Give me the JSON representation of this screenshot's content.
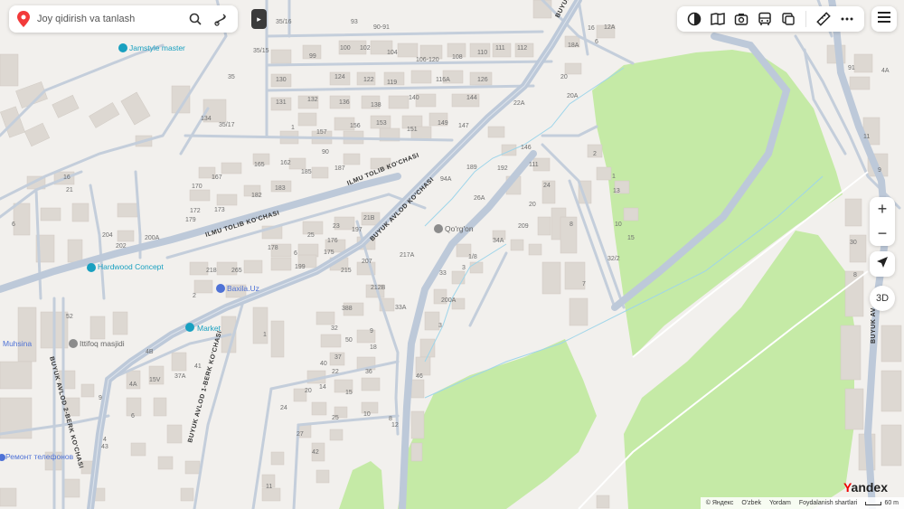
{
  "search": {
    "placeholder": "Joy qidirish va tanlash"
  },
  "map": {
    "streets": [
      {
        "name": "BUYUK AVLOD KO'CHASI"
      },
      {
        "name": "ILMU TOLIB KO'CHASI"
      },
      {
        "name": "ILMU TOLIB KO'CHASI"
      },
      {
        "name": "BUYUK AVLOD 1-BERK KO'CHASI"
      },
      {
        "name": "BUYUK AVLOD 2-BERK KO'CHASI"
      },
      {
        "name": "BUYUK AVLOD KO'CHASI"
      },
      {
        "name": "BUYUK AV"
      }
    ],
    "pois": [
      {
        "name": "Jamstyle master",
        "icon": "shop-pin-icon"
      },
      {
        "name": "Hardwood Concept",
        "icon": "shop-pin-icon"
      },
      {
        "name": "Baxila.Uz",
        "icon": "store-pin-icon"
      },
      {
        "name": "Market",
        "icon": "shop-pin-icon"
      },
      {
        "name": "Ittifoq masjidi",
        "icon": "mosque-pin-icon"
      },
      {
        "name": "Qo'rg'on",
        "icon": "landmark-pin-icon"
      },
      {
        "name": "Muhsina",
        "icon": "shop-pin-icon"
      },
      {
        "name": "Ремонт телефонов",
        "icon": "repair-pin-icon"
      }
    ],
    "house_numbers": [
      "35/16",
      "93",
      "90-91",
      "35/15",
      "99",
      "100",
      "102",
      "104",
      "106-120",
      "108",
      "110",
      "111",
      "112",
      "16",
      "12A",
      "18A",
      "6",
      "35",
      "130",
      "124",
      "122",
      "119",
      "116A",
      "126",
      "20",
      "91",
      "4A",
      "20A",
      "131",
      "132",
      "136",
      "138",
      "140",
      "144",
      "22A",
      "35/17",
      "134",
      "1",
      "157",
      "156",
      "153",
      "151",
      "149",
      "147",
      "146",
      "11",
      "90",
      "162",
      "165",
      "167",
      "170",
      "172",
      "173",
      "179",
      "182",
      "183",
      "185",
      "187",
      "189",
      "192",
      "111",
      "2",
      "9",
      "16",
      "94A",
      "24",
      "26A",
      "20",
      "8",
      "6",
      "21",
      "1",
      "13",
      "10",
      "15",
      "21B",
      "23",
      "25",
      "197",
      "200A",
      "202",
      "204",
      "176",
      "178",
      "175",
      "6",
      "199",
      "265",
      "218",
      "215",
      "217A",
      "207",
      "209",
      "34A",
      "32/2",
      "3",
      "1/8",
      "30",
      "2",
      "1",
      "52",
      "212B",
      "388",
      "200A",
      "33",
      "33A",
      "7",
      "3",
      "8",
      "32",
      "9",
      "50",
      "18",
      "4B",
      "4A",
      "15V",
      "37A",
      "41",
      "40",
      "37",
      "36",
      "22",
      "20",
      "14",
      "15",
      "24",
      "25",
      "10",
      "27",
      "9",
      "6",
      "4",
      "43",
      "42",
      "46",
      "8",
      "12",
      "11",
      "3",
      "1",
      "13"
    ]
  },
  "toolbar": {
    "tools": [
      {
        "name": "layers-icon"
      },
      {
        "name": "map-book-icon"
      },
      {
        "name": "camera-icon"
      },
      {
        "name": "bus-icon"
      },
      {
        "name": "panorama-icon"
      },
      {
        "name": "ruler-icon"
      },
      {
        "name": "more-icon"
      }
    ]
  },
  "controls": {
    "zoom_in": "+",
    "zoom_out": "−",
    "three_d": "3D"
  },
  "footer": {
    "copyright": "© Яндекс",
    "language": "O'zbek",
    "help": "Yordam",
    "terms": "Foydalanish shartlari",
    "scale": "60 m"
  },
  "logo": {
    "first": "Y",
    "rest": "andex"
  },
  "colors": {
    "park": "#c5eaa6",
    "road": "#bdc9d9",
    "building": "#ddd8d2",
    "background": "#f2f0ed",
    "poi": "#19a0c0"
  }
}
